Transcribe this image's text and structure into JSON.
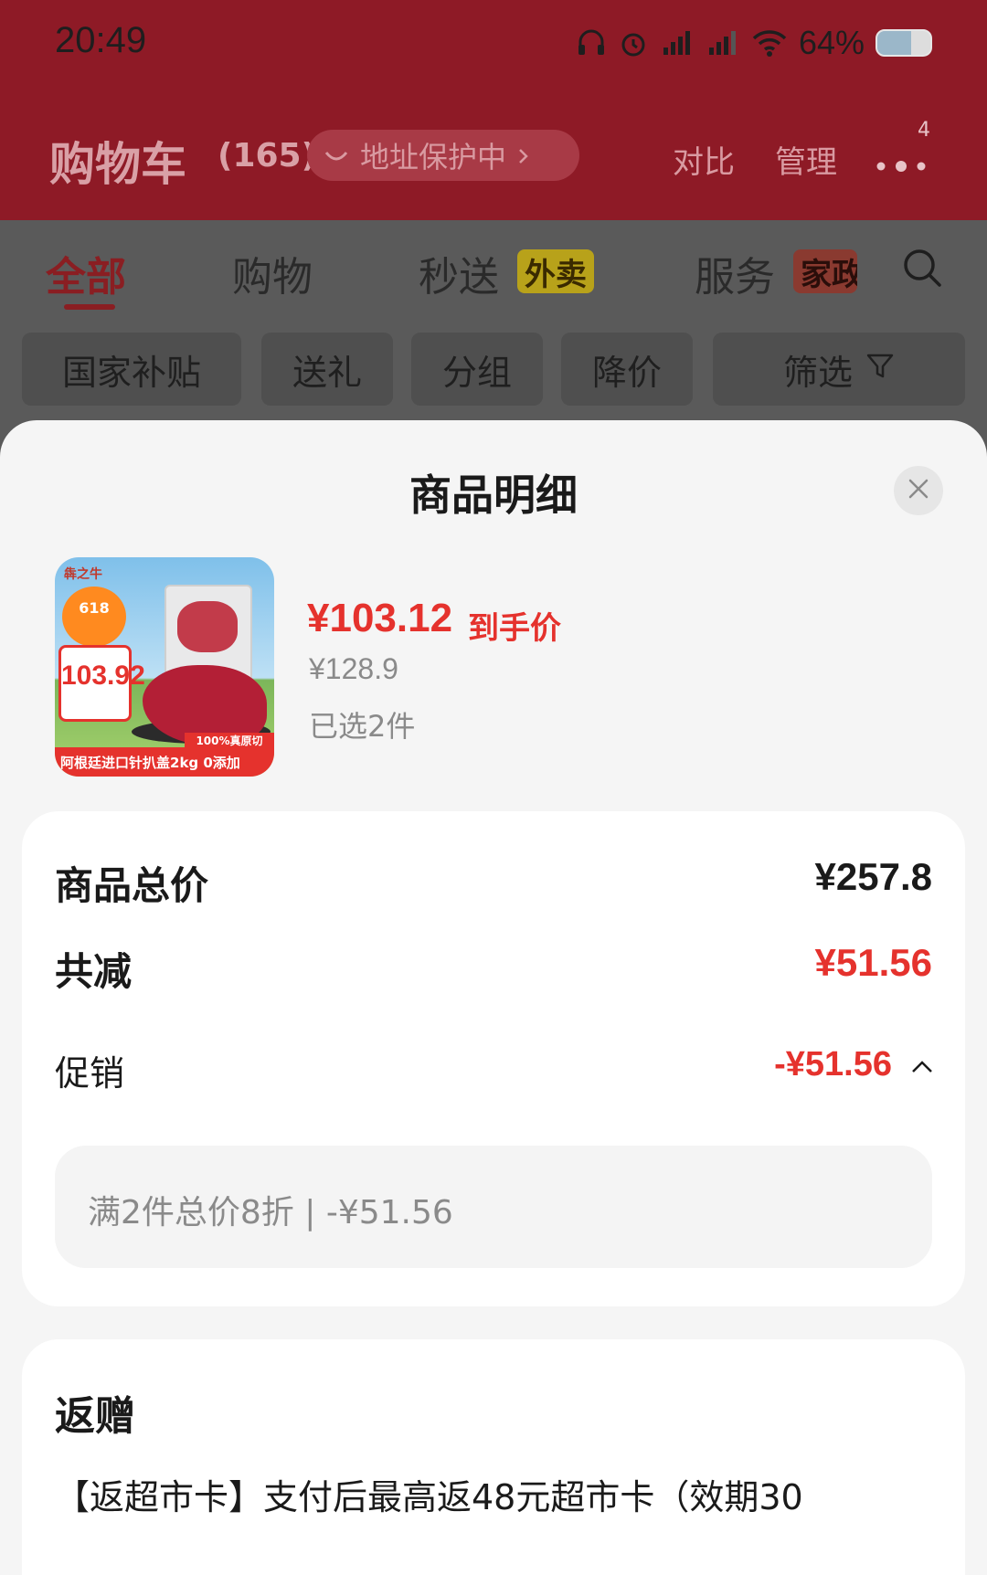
{
  "status_bar": {
    "time": "20:49",
    "battery_percent": "64%",
    "battery_level": 0.64
  },
  "header": {
    "title": "购物车",
    "count": "(165)",
    "address_chip": "地址保护中",
    "compare_label": "对比",
    "manage_label": "管理",
    "more_badge": "4"
  },
  "tabs": [
    {
      "label": "全部",
      "active": true
    },
    {
      "label": "购物",
      "active": false
    },
    {
      "label": "秒送",
      "badge": "外卖",
      "badge_color": "#b8a21a",
      "active": false
    },
    {
      "label": "服务",
      "badge": "家政",
      "badge_color": "#8a3a30",
      "active": false
    }
  ],
  "filter_chips": [
    "国家补贴",
    "送礼",
    "分组",
    "降价",
    "筛选"
  ],
  "sheet": {
    "title": "商品明细",
    "product": {
      "image_text": {
        "brand": "犇之牛",
        "promo_tag": "618",
        "price_tag": "103.92",
        "stripe": "100%真原切",
        "banner": "阿根廷进口针扒盖2kg 0添加"
      },
      "price": "¥103.12",
      "price_label": "到手价",
      "original_price": "¥128.9",
      "selected": "已选2件"
    },
    "summary": {
      "total_label": "商品总价",
      "total_value": "¥257.8",
      "discount_label": "共减",
      "discount_value": "¥51.56",
      "promo_label": "促销",
      "promo_value": "-¥51.56",
      "promo_detail": "满2件总价8折 | -¥51.56"
    },
    "gift": {
      "title": "返赠",
      "description": "【返超市卡】支付后最高返48元超市卡（效期30"
    }
  },
  "colors": {
    "accent_red": "#e5322d",
    "header_bg": "#8e1a26"
  }
}
